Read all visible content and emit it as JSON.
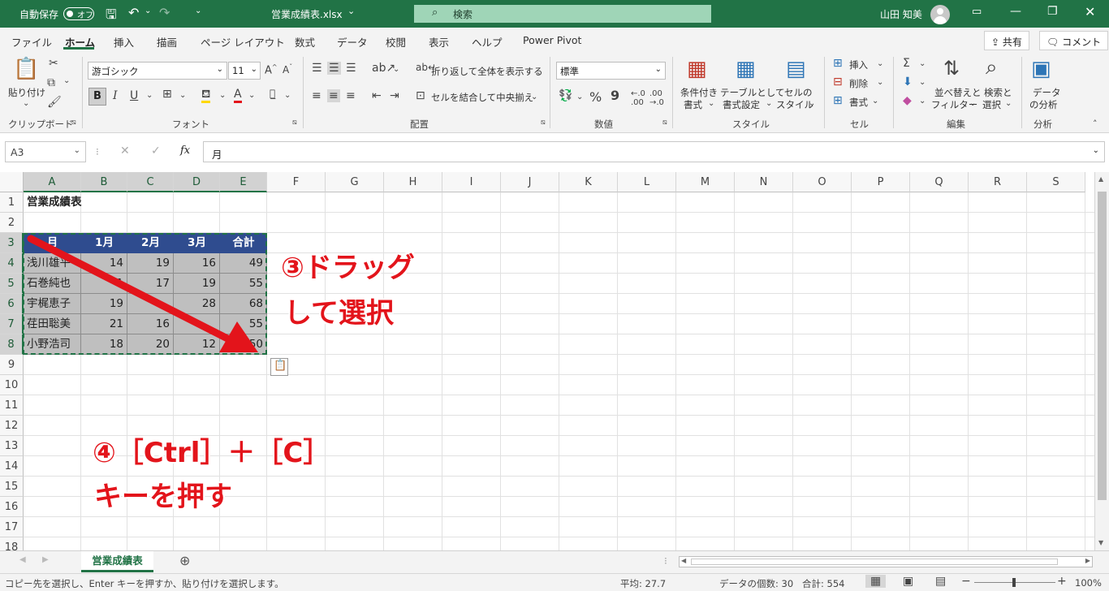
{
  "titlebar": {
    "autosave_label": "自動保存",
    "autosave_state": "オフ",
    "filename": "営業成績表.xlsx",
    "filename_caret": "⌄",
    "search_placeholder": "検索",
    "user": "山田 知美"
  },
  "menu": [
    "ファイル",
    "ホーム",
    "挿入",
    "描画",
    "ページ レイアウト",
    "数式",
    "データ",
    "校閲",
    "表示",
    "ヘルプ",
    "Power Pivot"
  ],
  "menu_active": "ホーム",
  "topright": {
    "share": "共有",
    "comments": "コメント"
  },
  "ribbon": {
    "clipboard": {
      "paste": "貼り付け",
      "group": "クリップボード"
    },
    "font": {
      "font_name": "游ゴシック",
      "font_size": "11",
      "group": "フォント",
      "bold": "B",
      "italic": "I",
      "underline": "U",
      "grow": "A^",
      "shrink": "A˅",
      "color_a": "A"
    },
    "alignment": {
      "wrap": "折り返して全体を表示する",
      "merge": "セルを結合して中央揃え",
      "group": "配置"
    },
    "number": {
      "format": "標準",
      "group": "数値",
      "percent": "%",
      "comma": "9"
    },
    "styles": {
      "cond": [
        "条件付き",
        "書式"
      ],
      "table": [
        "テーブルとして",
        "書式設定"
      ],
      "cell": [
        "セルの",
        "スタイル"
      ],
      "group": "スタイル"
    },
    "cells": {
      "insert": "挿入",
      "delete": "削除",
      "format": "書式",
      "group": "セル"
    },
    "editing": {
      "sort": [
        "並べ替えと",
        "フィルター"
      ],
      "find": [
        "検索と",
        "選択"
      ],
      "group": "編集"
    },
    "analysis": {
      "btn": [
        "データ",
        "の分析"
      ],
      "group": "分析"
    }
  },
  "formula_bar": {
    "namebox": "A3",
    "content": "月",
    "fx": "fx"
  },
  "columns": [
    "A",
    "B",
    "C",
    "D",
    "E",
    "F",
    "G",
    "H",
    "I",
    "J",
    "K",
    "L",
    "M",
    "N",
    "O",
    "P",
    "Q",
    "R",
    "S"
  ],
  "rows": [
    "1",
    "2",
    "3",
    "4",
    "5",
    "6",
    "7",
    "8",
    "9",
    "10",
    "11",
    "12",
    "13",
    "14",
    "15",
    "16",
    "17",
    "18"
  ],
  "sheet": {
    "title": "営業成績表",
    "header": [
      "月",
      "1月",
      "2月",
      "3月",
      "合計"
    ],
    "data": [
      [
        "浅川雄平",
        "14",
        "19",
        "16",
        "49"
      ],
      [
        "石巻純也",
        "1",
        "17",
        "19",
        "55"
      ],
      [
        "宇梶恵子",
        "19",
        "",
        "28",
        "68"
      ],
      [
        "荏田聡美",
        "21",
        "16",
        "",
        "55"
      ],
      [
        "小野浩司",
        "18",
        "20",
        "12",
        "50"
      ]
    ]
  },
  "annotations": {
    "drag_line1": "③ドラッグ",
    "drag_line2": "して選択",
    "copy_line1": "④［Ctrl］＋［C］",
    "copy_line2": "キーを押す"
  },
  "colors": {
    "annotation": "#e3141b",
    "excel_green": "#217346",
    "header_fill": "#2f4c8f",
    "body_fill": "#bfbfbf"
  },
  "tabs": {
    "sheet_name": "営業成績表",
    "add": "⊕"
  },
  "status": {
    "message": "コピー先を選択し、Enter キーを押すか、貼り付けを選択します。",
    "average": "平均: 27.7",
    "count": "データの個数: 30",
    "sum": "合計: 554",
    "zoom": "100%"
  }
}
